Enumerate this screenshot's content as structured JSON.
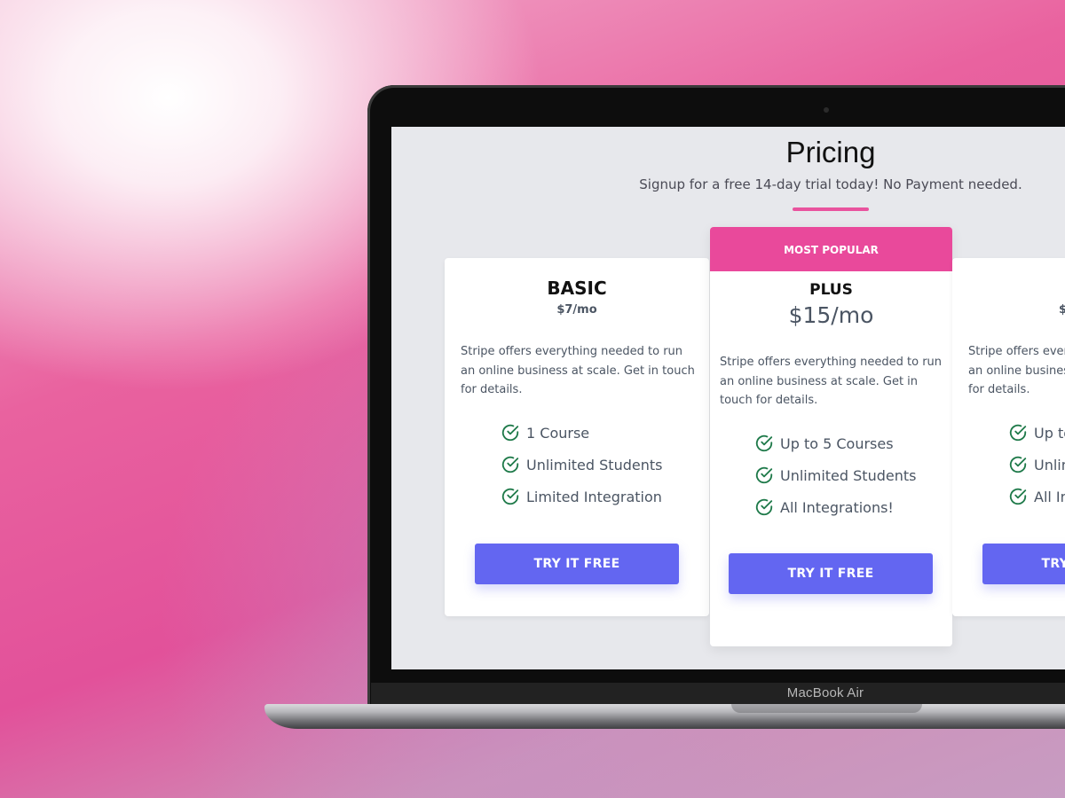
{
  "device": {
    "brand_label": "MacBook Air"
  },
  "header": {
    "title": "Pricing",
    "subtitle": "Signup for a free 14-day trial today! No Payment needed."
  },
  "colors": {
    "accent_pink": "#e9499b",
    "button_indigo": "#6366f1",
    "check_green": "#1f7a4a",
    "screen_background": "#e7e8ec"
  },
  "plans": [
    {
      "name": "BASIC",
      "price": "$7/mo",
      "description": "Stripe offers everything needed to run an online business at scale. Get in touch for details.",
      "features": [
        "1 Course",
        "Unlimited Students",
        "Limited Integration"
      ],
      "button_label": "TRY IT FREE"
    },
    {
      "badge": "MOST POPULAR",
      "name": "PLUS",
      "price": "$15/mo",
      "description": "Stripe offers everything needed to run an online business at scale. Get in touch for details.",
      "features": [
        "Up to 5 Courses",
        "Unlimited Students",
        "All Integrations!"
      ],
      "button_label": "TRY IT FREE"
    },
    {
      "price": "$",
      "description": "Stripe offers everything needed to run an online business at scale. Get in touch for details.",
      "features": [
        "Up to",
        "Unlimited",
        "All Integrations!"
      ],
      "button_label": "TRY IT FREE"
    }
  ],
  "icons": {
    "feature_check": "check-circle-icon"
  }
}
